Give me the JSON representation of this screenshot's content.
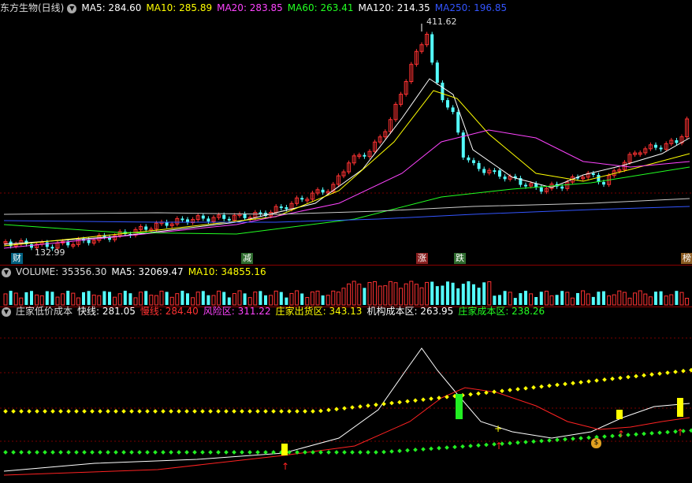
{
  "main": {
    "title": "东方生物(日线)",
    "ma": [
      {
        "label": "MA5: 284.60",
        "color": "#ffffff"
      },
      {
        "label": "MA10: 285.89",
        "color": "#ffff00"
      },
      {
        "label": "MA20: 283.85",
        "color": "#ff00ff"
      },
      {
        "label": "MA60: 263.41",
        "color": "#00ff00"
      },
      {
        "label": "MA120: 214.35",
        "color": "#ffffff"
      },
      {
        "label": "MA250: 196.85",
        "color": "#3355ff"
      }
    ],
    "high_label": "411.62",
    "low_label": "132.99",
    "tags": {
      "cai": "财",
      "jian": "减",
      "zhang": "涨",
      "die": "跌",
      "bang": "榜"
    }
  },
  "volume": {
    "label": "VOLUME: 35356.30",
    "ma5": "MA5: 32069.47",
    "ma10": "MA10: 34855.16"
  },
  "indicator": {
    "name": "庄家低价成本",
    "fast": "快线: 281.05",
    "slow": "慢线: 284.40",
    "risk": "风险区: 311.22",
    "dist": "庄家出货区: 343.13",
    "inst": "机构成本区: 263.95",
    "cost": "庄家成本区: 238.26"
  },
  "colors": {
    "up": "#ff3232",
    "down": "#54ffff",
    "sep": "#8b0000"
  }
}
